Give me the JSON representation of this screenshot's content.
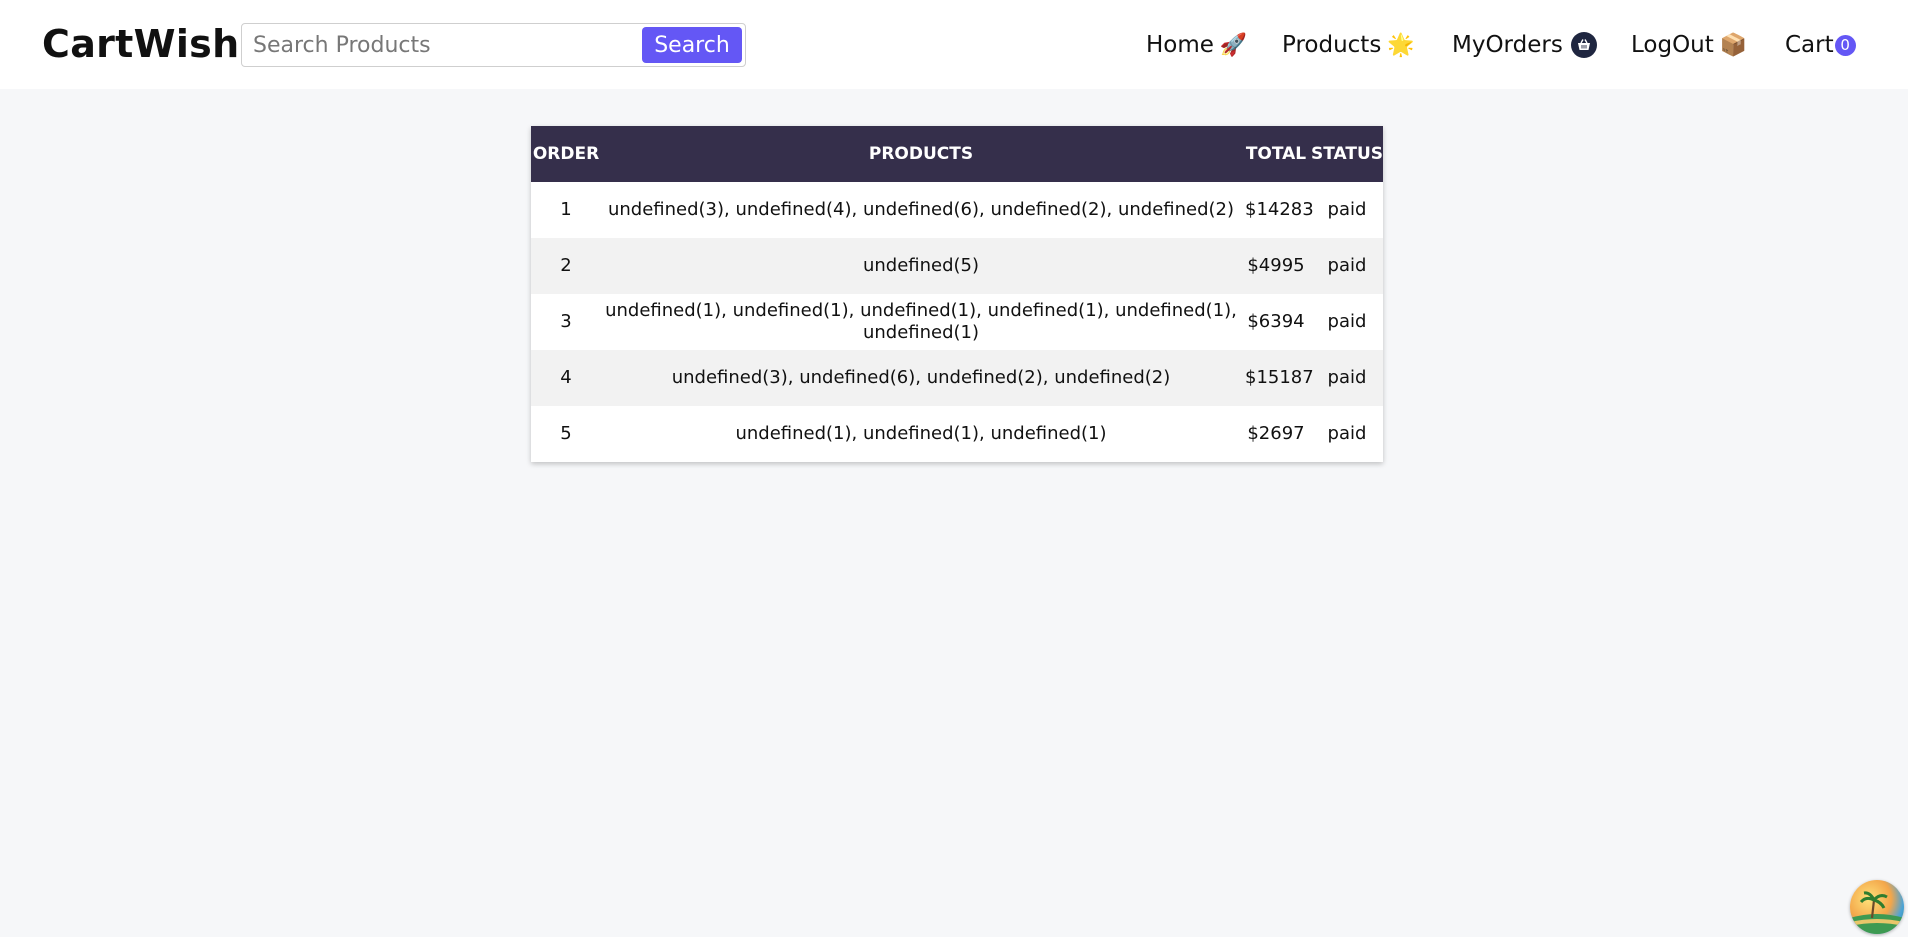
{
  "navbar": {
    "brand": "CartWish",
    "search": {
      "placeholder": "Search Products",
      "value": "",
      "button_label": "Search"
    },
    "links": [
      {
        "label": "Home",
        "icon": "rocket-icon",
        "glyph": "🚀"
      },
      {
        "label": "Products",
        "icon": "star-icon",
        "glyph": "🌟"
      },
      {
        "label": "MyOrders",
        "icon": "basket-icon"
      },
      {
        "label": "LogOut",
        "icon": "package-icon",
        "glyph": "📦"
      },
      {
        "label": "Cart",
        "badge": "0"
      }
    ]
  },
  "orders": {
    "headers": [
      "ORDER",
      "PRODUCTS",
      "TOTAL",
      "STATUS"
    ],
    "rows": [
      {
        "order": "1",
        "products": "undefined(3), undefined(4), undefined(6), undefined(2), undefined(2)",
        "total": "$14283",
        "status": "paid"
      },
      {
        "order": "2",
        "products": "undefined(5)",
        "total": "$4995",
        "status": "paid"
      },
      {
        "order": "3",
        "products": "undefined(1), undefined(1), undefined(1), undefined(1), undefined(1), undefined(1)",
        "total": "$6394",
        "status": "paid"
      },
      {
        "order": "4",
        "products": "undefined(3), undefined(6), undefined(2), undefined(2)",
        "total": "$15187",
        "status": "paid"
      },
      {
        "order": "5",
        "products": "undefined(1), undefined(1), undefined(1)",
        "total": "$2697",
        "status": "paid"
      }
    ]
  },
  "colors": {
    "accent": "#6457f5",
    "table_header": "#352f4b",
    "page_background": "#f6f7f9"
  }
}
